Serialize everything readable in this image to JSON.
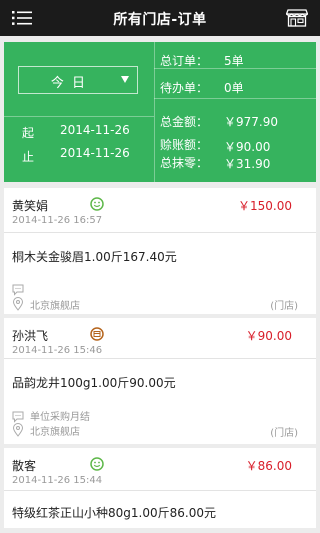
{
  "header": {
    "title": "所有门店-订单",
    "menu_icon": "hamburger-menu-icon",
    "store_icon": "store-icon"
  },
  "summary": {
    "period_select": {
      "value": "今 日"
    },
    "start_label": "起",
    "start_date": "2014-11-26",
    "end_label": "止",
    "end_date": "2014-11-26",
    "total_orders_label": "总订单：",
    "total_orders_value": "5单",
    "pending_label": "待办单：",
    "pending_value": "0单",
    "total_amount_label": "总金额：",
    "total_amount_value": "￥977.90",
    "credit_label": "赊账额：",
    "credit_value": "￥90.00",
    "rounding_label": "总抹零：",
    "rounding_value": "￥31.90",
    "bg_color": "#36b35e"
  },
  "orders": [
    {
      "customer": "黄笑娟",
      "status_icon": "smile-face-icon",
      "amount": "￥150.00",
      "time": "2014-11-26 16:57",
      "item": "桐木关金骏眉1.00斤167.40元",
      "note": "",
      "location": "北京旗舰店",
      "source": "(门店)"
    },
    {
      "customer": "孙洪飞",
      "status_icon": "credit-icon",
      "amount": "￥90.00",
      "time": "2014-11-26 15:46",
      "item": "品韵龙井100g1.00斤90.00元",
      "note": "单位采购月结",
      "location": "北京旗舰店",
      "source": "(门店)"
    },
    {
      "customer": "散客",
      "status_icon": "smile-face-icon",
      "amount": "￥86.00",
      "time": "2014-11-26 15:44",
      "item": "特级红茶正山小种80g1.00斤86.00元",
      "note": "",
      "location": "",
      "source": ""
    }
  ],
  "colors": {
    "accent_green": "#36b35e",
    "amount_red": "#d81e2a",
    "header_black": "#1b1b1b"
  }
}
